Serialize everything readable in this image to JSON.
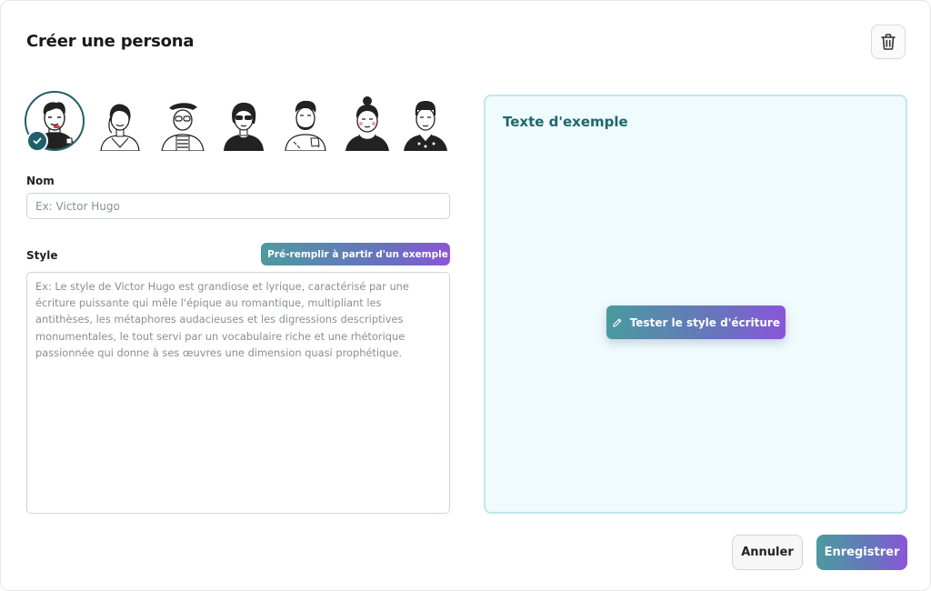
{
  "modal": {
    "title": "Créer une persona",
    "delete_icon": "trash-icon"
  },
  "avatars": [
    {
      "name": "avatar-1",
      "selected": true
    },
    {
      "name": "avatar-2",
      "selected": false
    },
    {
      "name": "avatar-3",
      "selected": false
    },
    {
      "name": "avatar-4",
      "selected": false
    },
    {
      "name": "avatar-5",
      "selected": false
    },
    {
      "name": "avatar-6",
      "selected": false
    },
    {
      "name": "avatar-7",
      "selected": false
    }
  ],
  "form": {
    "name_label": "Nom",
    "name_placeholder": "Ex: Victor Hugo",
    "name_value": "",
    "style_label": "Style",
    "prefill_label": "Pré-remplir à partir d'un exemple",
    "prefill_icon": "sparkles-icon",
    "style_placeholder": "Ex: Le style de Victor Hugo est grandiose et lyrique, caractérisé par une écriture puissante qui mêle l'épique au romantique, multipliant les antithèses, les métaphores audacieuses et les digressions descriptives monumentales, le tout servi par un vocabulaire riche et une rhétorique passionnée qui donne à ses œuvres une dimension quasi prophétique.",
    "style_value": ""
  },
  "example_panel": {
    "title": "Texte d'exemple",
    "test_button": "Tester le style d'écriture",
    "test_icon": "pencil-icon"
  },
  "footer": {
    "cancel": "Annuler",
    "save": "Enregistrer"
  },
  "colors": {
    "accent_dark": "#1f5f6a",
    "gradient_start": "#4a9a9f",
    "gradient_end": "#8b55d8",
    "panel_bg": "#effbfc",
    "panel_border": "#bfe7ee"
  }
}
